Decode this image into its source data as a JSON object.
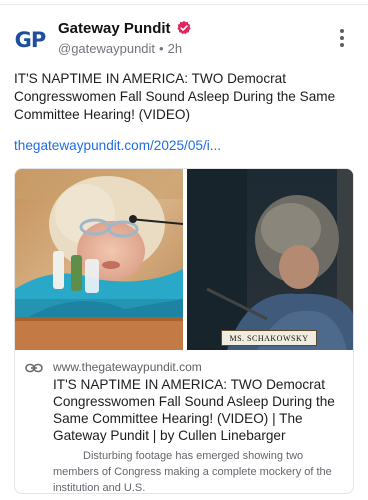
{
  "post": {
    "author_name": "Gateway Pundit",
    "handle": "@gatewaypundit",
    "separator": "•",
    "timestamp": "2h",
    "avatar_text": "GP",
    "text": "IT'S NAPTIME IN AMERICA: TWO Democrat Congresswomen Fall Sound Asleep During the Same Committee Hearing! (VIDEO)",
    "link_text": "thegatewaypundit.com/2025/05/i..."
  },
  "card": {
    "domain": "www.thegatewaypundit.com",
    "title": "IT'S NAPTIME IN AMERICA: TWO Democrat Congresswomen Fall Sound Asleep During the Same Committee Hearing! (VIDEO) | The Gateway Pundit | by Cullen Linebarger",
    "description": "Disturbing footage has emerged showing two members of Congress making a complete mockery of the institution and U.S.",
    "nameplate_text": "MS. SCHAKOWSKY"
  },
  "icons": {
    "verified": "verified-badge-icon",
    "more": "more-options-icon",
    "link": "link-icon"
  },
  "colors": {
    "link": "#1f6fe0",
    "verified_badge": "#e0245e",
    "avatar_text": "#1e4e9c"
  }
}
